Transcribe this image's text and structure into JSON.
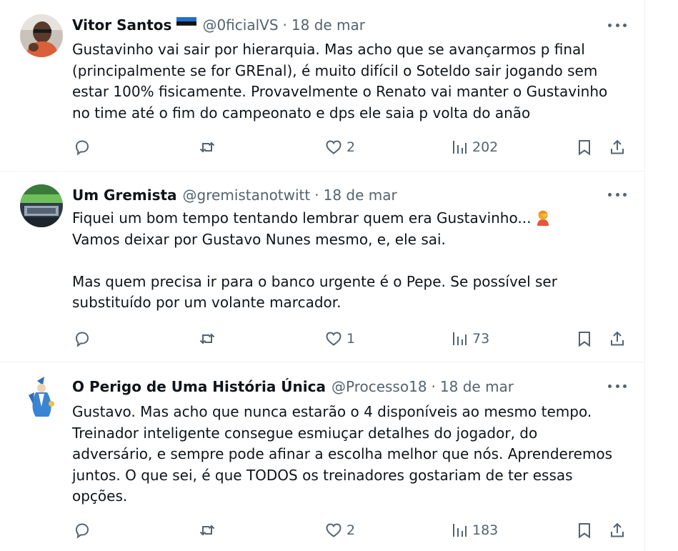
{
  "tweets": [
    {
      "name": "Vitor Santos",
      "handle": "@0ficialVS",
      "separator": "·",
      "date": "18 de mar",
      "lines": [
        "Gustavinho vai sair por hierarquia. Mas acho que se avançarmos p final",
        "(principalmente se for GREnal), é muito difícil o Soteldo sair jogando sem",
        "estar 100% fisicamente. Provavelmente o Renato vai manter o Gustavinho",
        "no time até o fim do campeonato e dps ele saia p volta do anão"
      ],
      "likes": "2",
      "views": "202"
    },
    {
      "name": "Um Gremista",
      "handle": "@gremistanotwitt",
      "separator": "·",
      "date": "18 de mar",
      "lines": [
        "Fiquei um bom tempo tentando lembrar quem era Gustavinho...",
        "Vamos deixar por Gustavo Nunes mesmo, e, ele sai.",
        "Mas quem precisa ir para o banco urgente é o Pepe. Se possível ser",
        "substituído por um volante marcador."
      ],
      "emoji": "woman-facepalming-emoji",
      "likes": "1",
      "views": "73"
    },
    {
      "name": "O Perigo de Uma História Única",
      "handle": "@Processo18",
      "separator": "·",
      "date": "18 de mar",
      "lines": [
        "Gustavo. Mas acho que nunca estarão o 4 disponíveis ao mesmo tempo.",
        "Treinador inteligente consegue esmiuçar detalhes do jogador, do",
        "adversário, e sempre pode afinar a escolha melhor que nós. Aprenderemos",
        "juntos. O que sei, é que TODOS os treinadores gostariam de ter essas",
        "opções."
      ],
      "likes": "2",
      "views": "183"
    }
  ],
  "icons": {
    "reply": "reply-icon",
    "retweet": "retweet-icon",
    "like": "heart-icon",
    "views": "views-icon",
    "bookmark": "bookmark-icon",
    "share": "share-icon",
    "more": "more-icon"
  },
  "colors": {
    "text": "#0f1419",
    "secondary": "#536471",
    "divider": "#eff3f4"
  }
}
